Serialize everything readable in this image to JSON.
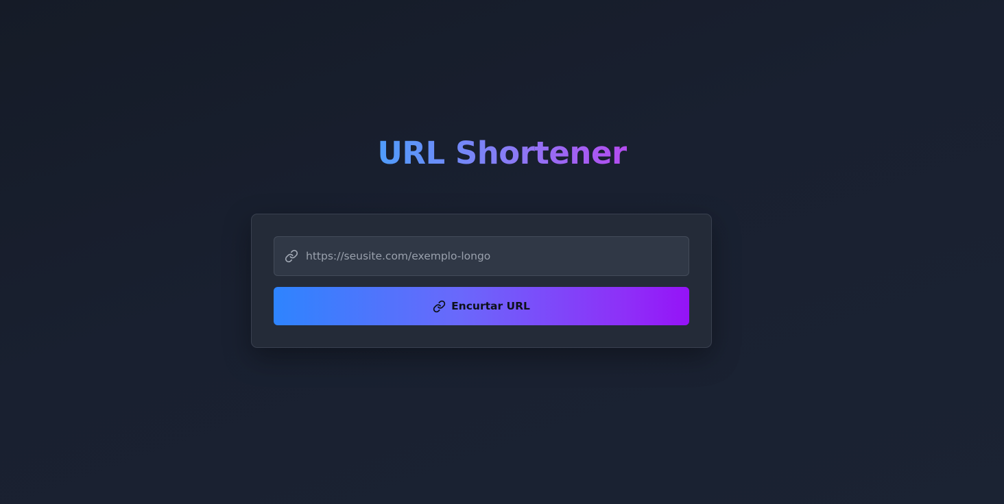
{
  "page": {
    "title": "URL Shortener"
  },
  "form": {
    "input": {
      "value": "",
      "placeholder": "https://seusite.com/exemplo-longo",
      "icon": "link-icon"
    },
    "button": {
      "label": "Encurtar URL",
      "icon": "link-icon"
    }
  },
  "colors": {
    "background": "#181f2c",
    "card": "#242b38",
    "input": "#303846",
    "title_gradient_start": "#4f9dfb",
    "title_gradient_end": "#b44cf0",
    "button_gradient_start": "#2e84fe",
    "button_gradient_end": "#9513f7"
  }
}
